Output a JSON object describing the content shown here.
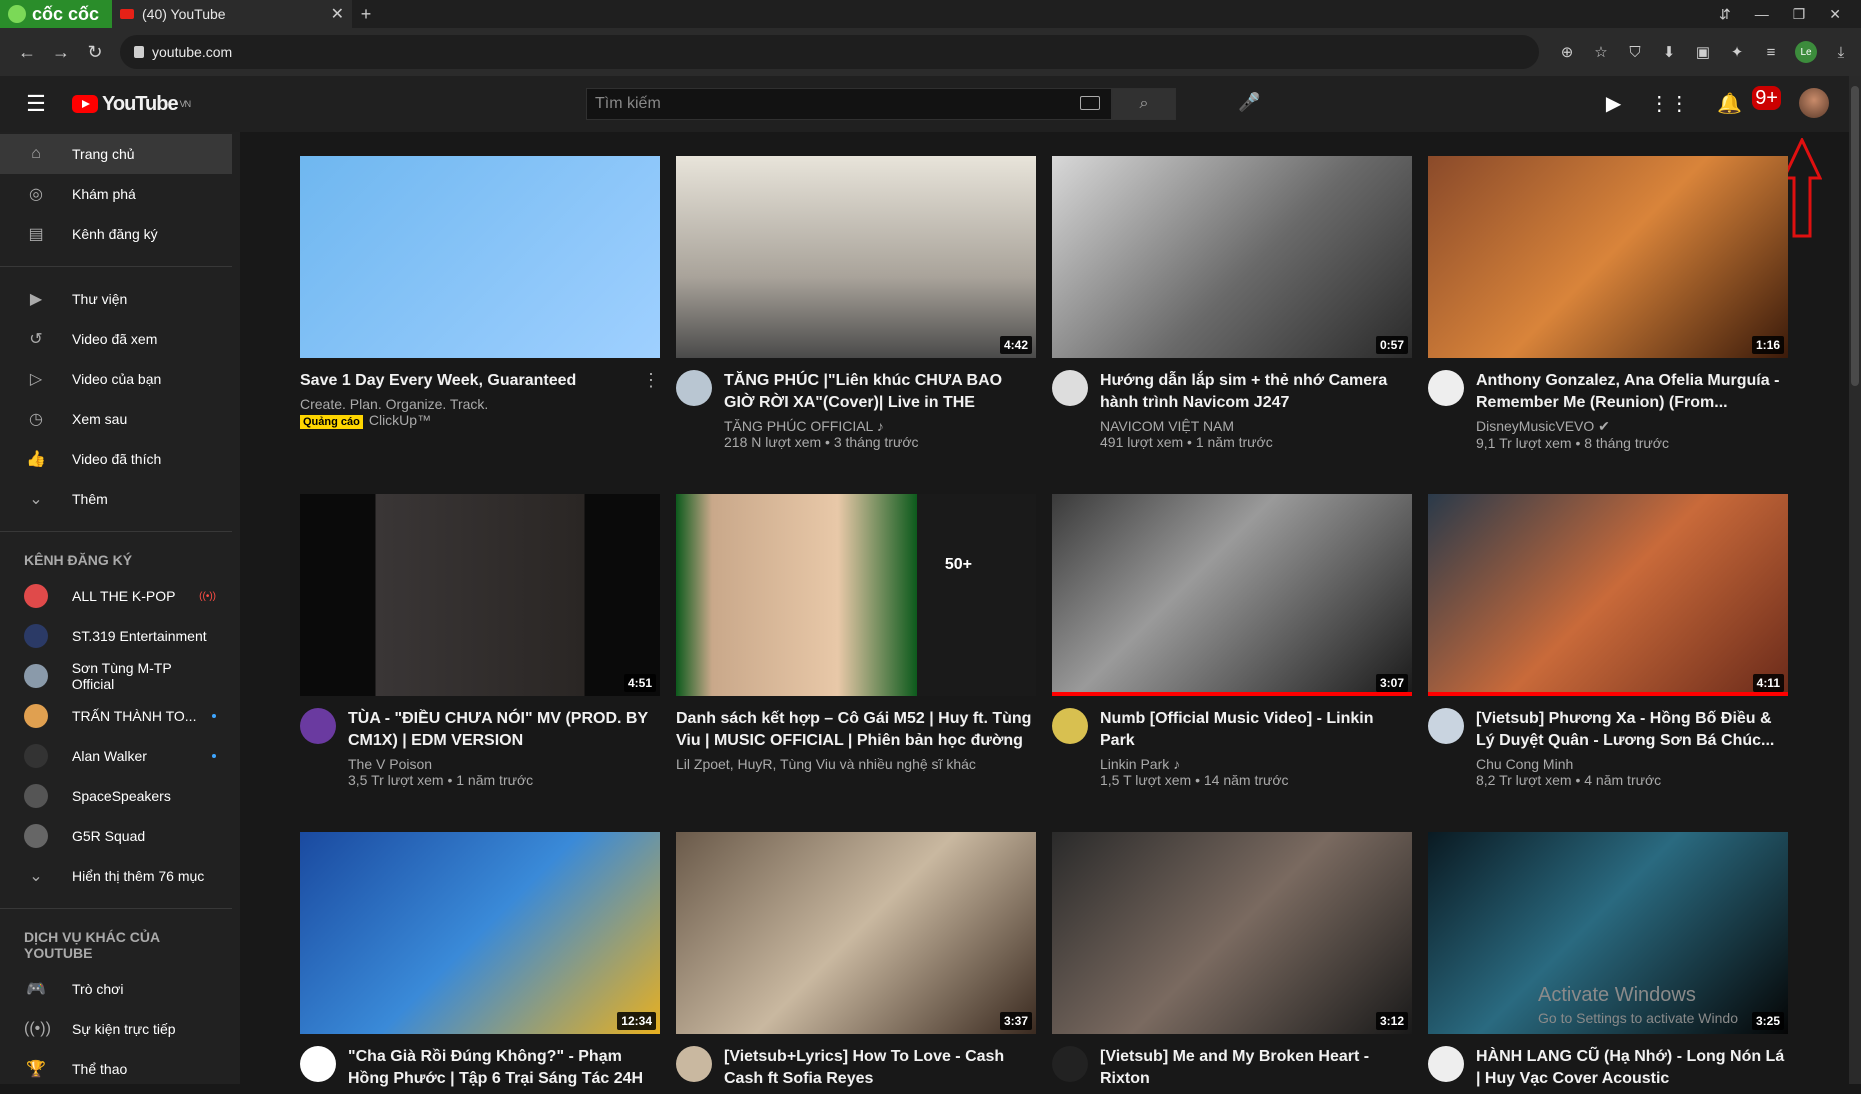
{
  "browser": {
    "brand": "cốc cốc",
    "tab_title": "(40) YouTube",
    "url": "youtube.com",
    "profile": "Le"
  },
  "header": {
    "logo": "YouTube",
    "region": "VN",
    "search_placeholder": "Tìm kiếm",
    "notif_count": "9+"
  },
  "sidebar": {
    "main": [
      {
        "label": "Trang chủ",
        "icon": "home-icon",
        "glyph": "⌂"
      },
      {
        "label": "Khám phá",
        "icon": "compass-icon",
        "glyph": "◎"
      },
      {
        "label": "Kênh đăng ký",
        "icon": "subscriptions-icon",
        "glyph": "▤"
      }
    ],
    "library": [
      {
        "label": "Thư viện",
        "icon": "library-icon",
        "glyph": "▶"
      },
      {
        "label": "Video đã xem",
        "icon": "history-icon",
        "glyph": "↺"
      },
      {
        "label": "Video của bạn",
        "icon": "your-videos-icon",
        "glyph": "▷"
      },
      {
        "label": "Xem sau",
        "icon": "clock-icon",
        "glyph": "◷"
      },
      {
        "label": "Video đã thích",
        "icon": "thumbs-up-icon",
        "glyph": "👍"
      },
      {
        "label": "Thêm",
        "icon": "chevron-down-icon",
        "glyph": "⌄"
      }
    ],
    "subs_heading": "KÊNH ĐĂNG KÝ",
    "subs": [
      {
        "label": "ALL THE K-POP",
        "color": "#e04a4a",
        "live": "((•))"
      },
      {
        "label": "ST.319 Entertainment",
        "color": "#2b3a66"
      },
      {
        "label": "Sơn Tùng M-TP Official",
        "color": "#8a9aaa"
      },
      {
        "label": "TRẤN THÀNH TO...",
        "color": "#e0a050",
        "dot": true
      },
      {
        "label": "Alan Walker",
        "color": "#333333",
        "dot": true
      },
      {
        "label": "SpaceSpeakers",
        "color": "#555555"
      },
      {
        "label": "G5R Squad",
        "color": "#666666"
      }
    ],
    "show_more": "Hiển thị thêm 76 mục",
    "services_heading": "DỊCH VỤ KHÁC CỦA YOUTUBE",
    "services": [
      {
        "label": "Trò chơi",
        "icon": "gamepad-icon",
        "glyph": "🎮"
      },
      {
        "label": "Sự kiện trực tiếp",
        "icon": "live-icon",
        "glyph": "((•))"
      },
      {
        "label": "Thể thao",
        "icon": "trophy-icon",
        "glyph": "🏆"
      }
    ]
  },
  "videos": [
    {
      "title": "Save 1 Day Every Week, Guaranteed",
      "channel": "Create. Plan. Organize. Track.",
      "stats": "ClickUp™",
      "ad": "Quảng cáo",
      "duration": "",
      "bg": "linear-gradient(135deg,#6fb7f0,#9fd0ff)",
      "av": ""
    },
    {
      "title": "TĂNG PHÚC |\"Liên khúc CHƯA BAO GIỜ RỜI XA\"(Cover)| Live in THE ROOFTOP...",
      "channel": "TĂNG PHÚC OFFICIAL ♪",
      "stats": "218 N lượt xem • 3 tháng trước",
      "duration": "4:42",
      "bg": "linear-gradient(180deg,#e8e4da,#a9a39a 60%,#4a4a4a)",
      "av": "#b9c6d2"
    },
    {
      "title": "Hướng dẫn lắp sim + thẻ nhớ Camera hành trình Navicom J247",
      "channel": "NAVICOM VIỆT NAM",
      "stats": "491 lượt xem • 1 năm trước",
      "duration": "0:57",
      "bg": "linear-gradient(135deg,#d8d8d8,#6a6a6a 55%,#2a2a2a)",
      "av": "#dddddd"
    },
    {
      "title": "Anthony Gonzalez, Ana Ofelia Murguía - Remember Me (Reunion) (From...",
      "channel": "DisneyMusicVEVO ✔",
      "stats": "9,1 Tr lượt xem • 8 tháng trước",
      "duration": "1:16",
      "bg": "linear-gradient(135deg,#8a4a2a,#d9843a 50%,#3a1a0a)",
      "av": "#eeeeee"
    },
    {
      "title": "TÙA - \"ĐIỀU CHƯA NÓI\" MV (PROD. BY CM1X) | EDM VERSION",
      "channel": "The V Poison",
      "stats": "3,5 Tr lượt xem • 1 năm trước",
      "duration": "4:51",
      "bg": "linear-gradient(90deg,#0a0a0a 21%,#3a3636 21%,#2a2624 79%,#0a0a0a 79%)",
      "av": "#6a3aa0"
    },
    {
      "title": "Danh sách kết hợp – Cô Gái M52 | Huy ft. Tùng Viu | MUSIC OFFICIAL | Phiên bản học đường",
      "channel": "Lil Zpoet, HuyR, Tùng Viu và nhiều nghệ sĩ khác",
      "stats": "",
      "duration": "",
      "bg": "linear-gradient(90deg,#0c5a1c 0%,#c9a88a 10%,#e8c8a8 45%,#0c5a1c 67%,#1a1a1a 67%)",
      "av": "",
      "mix": "50+"
    },
    {
      "title": "Numb [Official Music Video] - Linkin Park",
      "channel": "Linkin Park ♪",
      "stats": "1,5 T lượt xem • 14 năm trước",
      "duration": "3:07",
      "bg": "linear-gradient(135deg,#3a3a3a,#9a9a9a 40%,#1a1a1a)",
      "av": "#d8c050",
      "progress": 1
    },
    {
      "title": "[Vietsub] Phương Xa - Hồng Bố Điều & Lý Duyệt Quân - Lương Sơn Bá Chúc...",
      "channel": "Chu Cong Minh",
      "stats": "8,2 Tr lượt xem • 4 năm trước",
      "duration": "4:11",
      "bg": "linear-gradient(135deg,#2a3a4a,#c96a3a 50%,#6a2a1a)",
      "av": "#c9d4e0",
      "progress": 1
    },
    {
      "title": "\"Cha Già Rồi Đúng Không?\" - Phạm Hồng Phước | Tập 6 Trại Sáng Tác 24H",
      "channel": "",
      "stats": "",
      "duration": "12:34",
      "bg": "linear-gradient(135deg,#1a4aa0,#3a8ad8 50%,#e8b020)",
      "av": "#ffffff"
    },
    {
      "title": "[Vietsub+Lyrics] How To Love - Cash Cash ft Sofia Reyes",
      "channel": "",
      "stats": "",
      "duration": "3:37",
      "bg": "linear-gradient(135deg,#6a5a4a,#c9b8a0 50%,#3a2a20)",
      "av": "#c9b8a0"
    },
    {
      "title": "[Vietsub] Me and My Broken Heart - Rixton",
      "channel": "",
      "stats": "",
      "duration": "3:12",
      "bg": "linear-gradient(135deg,#2a2a2a,#7a6a60 50%,#1a1a1a)",
      "av": "#222222"
    },
    {
      "title": "HÀNH LANG CŨ (Hạ Nhớ) - Long Nón Lá | Huy Vạc Cover Acoustic",
      "channel": "",
      "stats": "",
      "duration": "3:25",
      "bg": "linear-gradient(135deg,#0a1a22,#2a6a80 45%,#050505)",
      "av": "#eeeeee"
    }
  ],
  "watermark": {
    "line1": "Activate Windows",
    "line2": "Go to Settings to activate Windo"
  }
}
